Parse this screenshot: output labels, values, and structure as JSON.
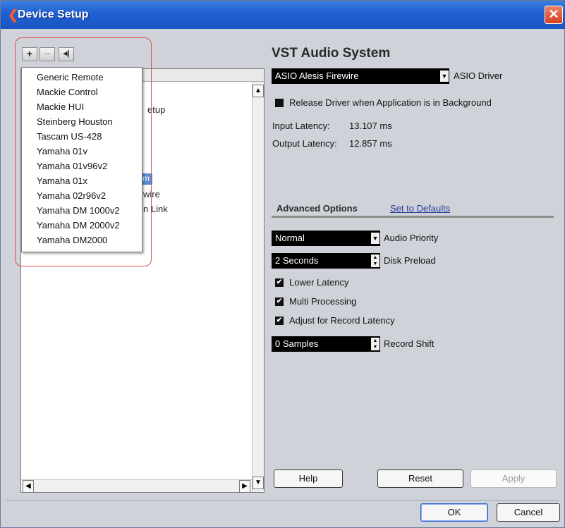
{
  "window": {
    "title": "Device Setup",
    "close_glyph": "✕",
    "logo_icon": "cubase-logo-icon"
  },
  "toolbar": {
    "add": "+",
    "remove": "−",
    "reset": "◂|"
  },
  "popup": {
    "items": [
      "Generic Remote",
      "Mackie Control",
      "Mackie HUI",
      "Steinberg Houston",
      "Tascam US-428",
      "Yamaha 01v",
      "Yamaha 01v96v2",
      "Yamaha 01x",
      "Yamaha 02r96v2",
      "Yamaha DM 1000v2",
      "Yamaha DM 2000v2",
      "Yamaha DM2000"
    ]
  },
  "tree_fragments": {
    "a": "etup",
    "b": "m",
    "c": "wire",
    "d": "n Link"
  },
  "vst": {
    "title": "VST Audio System",
    "driver_value": "ASIO Alesis Firewire",
    "driver_label": "ASIO Driver",
    "release_label": "Release Driver when Application is in Background",
    "input_latency_label": "Input Latency:",
    "input_latency_value": "13.107 ms",
    "output_latency_label": "Output Latency:",
    "output_latency_value": "12.857 ms"
  },
  "advanced": {
    "title": "Advanced Options",
    "defaults_link": "Set to Defaults",
    "priority_value": "Normal",
    "priority_label": "Audio Priority",
    "preload_value": "2 Seconds",
    "preload_label": "Disk Preload",
    "lower_latency": "Lower Latency",
    "multi_processing": "Multi Processing",
    "adjust_record": "Adjust for Record Latency",
    "shift_value": "0 Samples",
    "shift_label": "Record Shift",
    "check_glyph": "✔"
  },
  "buttons": {
    "help": "Help",
    "reset": "Reset",
    "apply": "Apply",
    "ok": "OK",
    "cancel": "Cancel"
  }
}
